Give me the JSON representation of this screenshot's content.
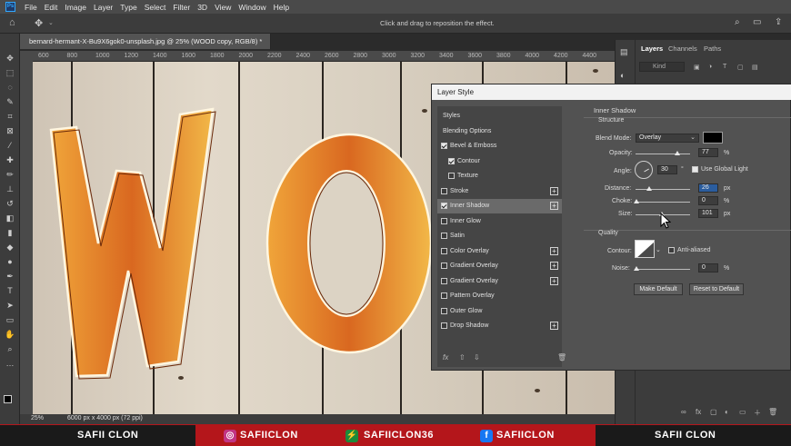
{
  "menubar": {
    "items": [
      "File",
      "Edit",
      "Image",
      "Layer",
      "Type",
      "Select",
      "Filter",
      "3D",
      "View",
      "Window",
      "Help"
    ]
  },
  "options": {
    "hint": "Click and drag to reposition the effect."
  },
  "document": {
    "tab_title": "bernard-hermant-X-Bu9X6gok0-unsplash.jpg @ 25% (WOOD copy, RGB/8) *",
    "ruler_top": [
      "600",
      "800",
      "1000",
      "1200",
      "1400",
      "1600",
      "1800",
      "2000",
      "2200",
      "2400",
      "2600",
      "2800",
      "3000",
      "3200",
      "3400",
      "3600",
      "3800",
      "4000",
      "4200",
      "4400"
    ],
    "zoom": "25%",
    "size": "6000 px x 4000 px (72 ppi)"
  },
  "layers_panel": {
    "tabs": [
      "Layers",
      "Channels",
      "Paths"
    ],
    "kind_placeholder": "Kind"
  },
  "dialog": {
    "title": "Layer Style",
    "styles": [
      {
        "label": "Styles",
        "checkbox": false,
        "checked": false,
        "plus": false
      },
      {
        "label": "Blending Options",
        "checkbox": false,
        "checked": false,
        "plus": false
      },
      {
        "label": "Bevel & Emboss",
        "checkbox": true,
        "checked": true,
        "plus": false
      },
      {
        "label": "Contour",
        "checkbox": true,
        "checked": true,
        "plus": false
      },
      {
        "label": "Texture",
        "checkbox": true,
        "checked": false,
        "plus": false
      },
      {
        "label": "Stroke",
        "checkbox": true,
        "checked": false,
        "plus": true
      },
      {
        "label": "Inner Shadow",
        "checkbox": true,
        "checked": true,
        "plus": true
      },
      {
        "label": "Inner Glow",
        "checkbox": true,
        "checked": false,
        "plus": false
      },
      {
        "label": "Satin",
        "checkbox": true,
        "checked": false,
        "plus": false
      },
      {
        "label": "Color Overlay",
        "checkbox": true,
        "checked": false,
        "plus": true
      },
      {
        "label": "Gradient Overlay",
        "checkbox": true,
        "checked": false,
        "plus": true
      },
      {
        "label": "Gradient Overlay",
        "checkbox": true,
        "checked": false,
        "plus": true
      },
      {
        "label": "Pattern Overlay",
        "checkbox": true,
        "checked": false,
        "plus": false
      },
      {
        "label": "Outer Glow",
        "checkbox": true,
        "checked": false,
        "plus": false
      },
      {
        "label": "Drop Shadow",
        "checkbox": true,
        "checked": false,
        "plus": true
      }
    ],
    "section_title": "Inner Shadow",
    "structure_title": "Structure",
    "blend_mode_label": "Blend Mode:",
    "blend_mode_value": "Overlay",
    "shadow_color": "#000000",
    "opacity_label": "Opacity:",
    "opacity_value": "77",
    "opacity_unit": "%",
    "opacity_level": 0.77,
    "angle_label": "Angle:",
    "angle_value": "30",
    "angle_unit": "°",
    "global_light_label": "Use Global Light",
    "global_light_checked": true,
    "distance_label": "Distance:",
    "distance_value": "26",
    "distance_unit": "px",
    "choke_label": "Choke:",
    "choke_value": "0",
    "choke_unit": "%",
    "size_label": "Size:",
    "size_value": "101",
    "size_unit": "px",
    "quality_title": "Quality",
    "contour_label": "Contour:",
    "antialiased_label": "Anti-aliased",
    "noise_label": "Noise:",
    "noise_value": "0",
    "noise_unit": "%",
    "make_default": "Make Default",
    "reset_default": "Reset to Default",
    "fx_label": "fx"
  },
  "banner": {
    "left": "SAFII CLON",
    "instagram": "SAFIICLON",
    "gitlab": "SAFIICLON36",
    "facebook": "SAFIICLON",
    "right": "SAFII CLON"
  }
}
